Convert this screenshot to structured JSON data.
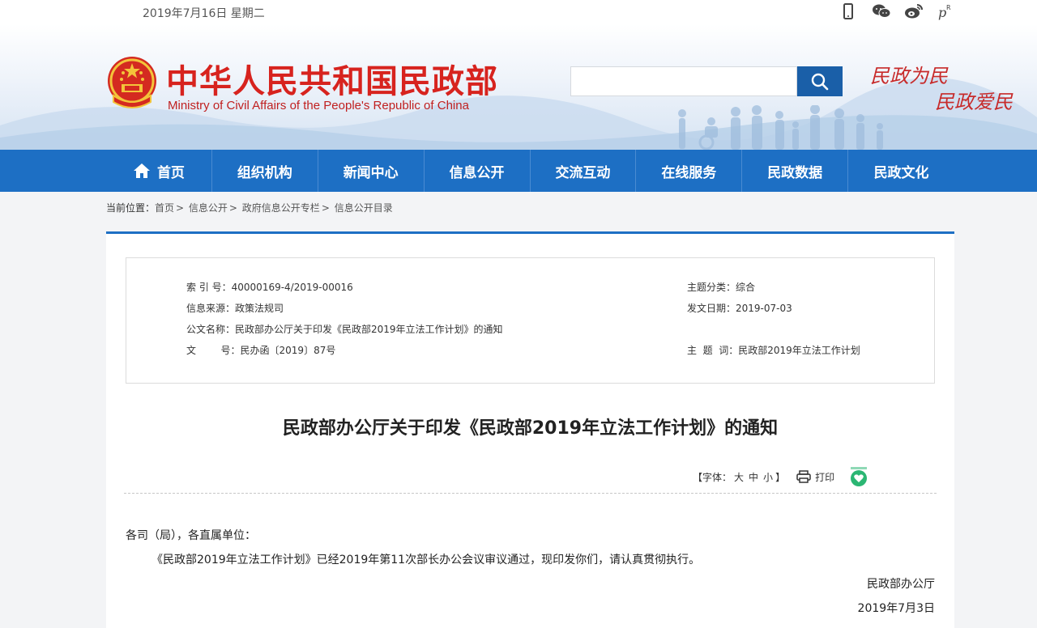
{
  "topbar": {
    "date": "2019年7月16日 星期二",
    "icons": [
      "mobile-icon",
      "wechat-icon",
      "weibo-icon",
      "rss-icon"
    ]
  },
  "header": {
    "title": "中华人民共和国民政部",
    "subtitle": "Ministry of Civil Affairs of the People's Republic of China",
    "search_placeholder": "",
    "slogan_line1": "民政为民",
    "slogan_line2": "民政爱民"
  },
  "nav": {
    "items": [
      "首页",
      "组织机构",
      "新闻中心",
      "信息公开",
      "交流互动",
      "在线服务",
      "民政数据",
      "民政文化"
    ]
  },
  "breadcrumb": {
    "prefix": "当前位置：",
    "items": [
      "首页",
      "信息公开",
      "政府信息公开专栏",
      "信息公开目录"
    ]
  },
  "info": {
    "index_label": "索  引  号：",
    "index_value": "40000169-4/2019-00016",
    "source_label": "信息来源：",
    "source_value": "政策法规司",
    "name_label": "公文名称：",
    "name_value": "民政部办公厅关于印发《民政部2019年立法工作计划》的通知",
    "docno_label": "文        号：",
    "docno_value": "民办函〔2019〕87号",
    "category_label": "主题分类：",
    "category_value": "综合",
    "date_label": "发文日期：",
    "date_value": "2019-07-03",
    "keywords_label": "主  题  词：",
    "keywords_value": "民政部2019年立法工作计划"
  },
  "doc": {
    "title": "民政部办公厅关于印发《民政部2019年立法工作计划》的通知",
    "font_label": "【字体：",
    "font_large": "大",
    "font_medium": "中",
    "font_small": "小",
    "font_end": "】",
    "print_label": "打印",
    "greeting": "各司（局），各直属单位：",
    "paragraph": "《民政部2019年立法工作计划》已经2019年第11次部长办公会议审议通过，现印发你们，请认真贯彻执行。",
    "signer": "民政部办公厅",
    "sign_date": "2019年7月3日"
  },
  "colors": {
    "nav_blue": "#1d6fc4",
    "title_red": "#d7231e",
    "search_button": "#1a5fa8",
    "share_green": "#2bb673"
  }
}
